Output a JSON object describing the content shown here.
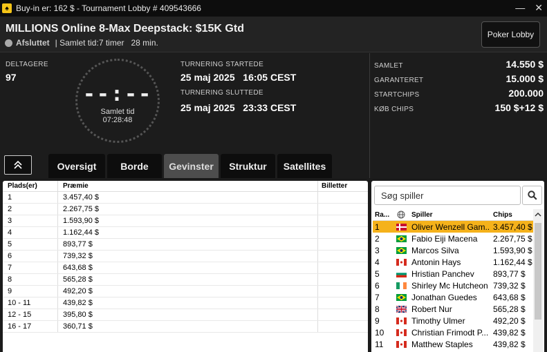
{
  "window": {
    "title": "Buy-in er: 162 $ - Tournament Lobby # 409543666",
    "minimize": "—",
    "close": "✕"
  },
  "header": {
    "title": "MILLIONS Online 8-Max Deepstack: $15K Gtd",
    "status": "Afsluttet",
    "total_time": "| Samlet tid:7 timer   28 min.",
    "lobby_button": "Poker Lobby"
  },
  "info": {
    "participants_label": "DELTAGERE",
    "participants_value": "97",
    "clock_digits": "--:--",
    "clock_label": "Samlet tid",
    "clock_time": "07:28:48",
    "started_label": "TURNERING STARTEDE",
    "started_value": "25 maj 2025   16:05 CEST",
    "ended_label": "TURNERING SLUTTEDE",
    "ended_value": "25 maj 2025   23:33 CEST"
  },
  "stats": [
    {
      "label": "SAMLET",
      "value": "14.550 $"
    },
    {
      "label": "GARANTERET",
      "value": "15.000 $"
    },
    {
      "label": "STARTCHIPS",
      "value": "200.000"
    },
    {
      "label": "KØB CHIPS",
      "value": "150 $+12 $"
    }
  ],
  "tabs": [
    "Oversigt",
    "Borde",
    "Gevinster",
    "Struktur",
    "Satellites"
  ],
  "active_tab": "Gevinster",
  "prizes": {
    "headers": {
      "place": "Plads(er)",
      "prize": "Præmie",
      "tickets": "Billetter"
    },
    "rows": [
      {
        "place": "1",
        "prize": "3.457,40 $"
      },
      {
        "place": "2",
        "prize": "2.267,75 $"
      },
      {
        "place": "3",
        "prize": "1.593,90 $"
      },
      {
        "place": "4",
        "prize": "1.162,44 $"
      },
      {
        "place": "5",
        "prize": "893,77 $"
      },
      {
        "place": "6",
        "prize": "739,32 $"
      },
      {
        "place": "7",
        "prize": "643,68 $"
      },
      {
        "place": "8",
        "prize": "565,28 $"
      },
      {
        "place": "9",
        "prize": "492,20 $"
      },
      {
        "place": "10 - 11",
        "prize": "439,82 $"
      },
      {
        "place": "12 - 15",
        "prize": "395,80 $"
      },
      {
        "place": "16 - 17",
        "prize": "360,71 $"
      }
    ]
  },
  "players": {
    "search_placeholder": "Søg spiller",
    "headers": {
      "rank": "Ra...",
      "player": "Spiller",
      "chips": "Chips"
    },
    "rows": [
      {
        "rank": "1",
        "flag": "dk",
        "name": "Oliver Wenzell Gam...",
        "chips": "3.457,40 $"
      },
      {
        "rank": "2",
        "flag": "br",
        "name": "Fabio Eiji Macena",
        "chips": "2.267,75 $"
      },
      {
        "rank": "3",
        "flag": "br",
        "name": "Marcos Silva",
        "chips": "1.593,90 $"
      },
      {
        "rank": "4",
        "flag": "ca",
        "name": "Antonin Hays",
        "chips": "1.162,44 $"
      },
      {
        "rank": "5",
        "flag": "bg",
        "name": "Hristian Panchev",
        "chips": "893,77 $"
      },
      {
        "rank": "6",
        "flag": "ie",
        "name": "Shirley Mc Hutcheon",
        "chips": "739,32 $"
      },
      {
        "rank": "7",
        "flag": "br",
        "name": "Jonathan Guedes",
        "chips": "643,68 $"
      },
      {
        "rank": "8",
        "flag": "gb",
        "name": "Robert Nur",
        "chips": "565,28 $"
      },
      {
        "rank": "9",
        "flag": "ca",
        "name": "Timothy Ulmer",
        "chips": "492,20 $"
      },
      {
        "rank": "10",
        "flag": "ca",
        "name": "Christian Frimodt P...",
        "chips": "439,82 $"
      },
      {
        "rank": "11",
        "flag": "ca",
        "name": "Matthew Staples",
        "chips": "439,82 $"
      }
    ]
  }
}
